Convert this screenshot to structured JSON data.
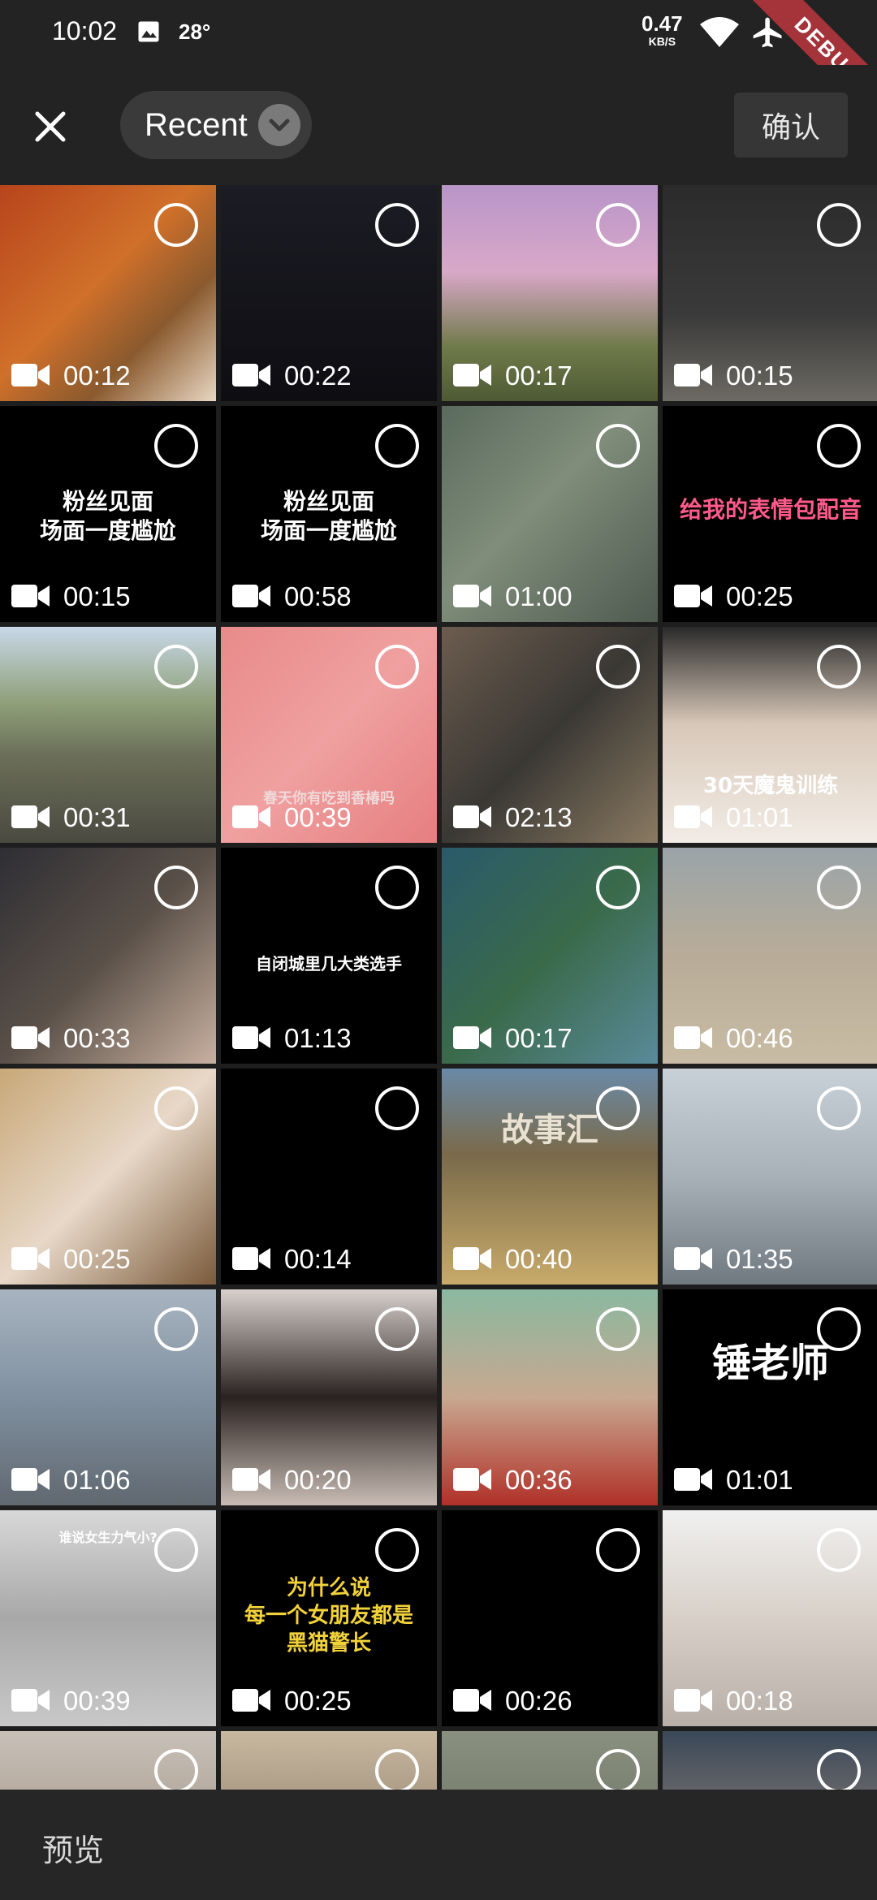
{
  "status_bar": {
    "time": "10:02",
    "temperature": "28°",
    "speed_value": "0.47",
    "speed_unit": "KB/S",
    "debug_label": "DEBUG"
  },
  "toolbar": {
    "album_label": "Recent",
    "confirm_label": "确认"
  },
  "bottom_bar": {
    "preview_label": "预览"
  },
  "colors": {
    "background": "#1e1e1e",
    "bar": "#232323",
    "pill": "#3a3a3a",
    "debug": "#a5333a"
  },
  "videos": [
    {
      "duration": "00:12",
      "overlay": ""
    },
    {
      "duration": "00:22",
      "overlay": ""
    },
    {
      "duration": "00:17",
      "overlay": ""
    },
    {
      "duration": "00:15",
      "overlay": ""
    },
    {
      "duration": "00:15",
      "overlay": "粉丝见面\n场面一度尴尬"
    },
    {
      "duration": "00:58",
      "overlay": "粉丝见面\n场面一度尴尬"
    },
    {
      "duration": "01:00",
      "overlay": ""
    },
    {
      "duration": "00:25",
      "overlay": "给我的表情包配音"
    },
    {
      "duration": "00:31",
      "overlay": ""
    },
    {
      "duration": "00:39",
      "overlay": "春天你有吃到香椿吗"
    },
    {
      "duration": "02:13",
      "overlay": ""
    },
    {
      "duration": "01:01",
      "overlay": "30天魔鬼训练"
    },
    {
      "duration": "00:33",
      "overlay": ""
    },
    {
      "duration": "01:13",
      "overlay": "自闭城里几大类选手"
    },
    {
      "duration": "00:17",
      "overlay": ""
    },
    {
      "duration": "00:46",
      "overlay": ""
    },
    {
      "duration": "00:25",
      "overlay": ""
    },
    {
      "duration": "00:14",
      "overlay": ""
    },
    {
      "duration": "00:40",
      "overlay": "故事汇"
    },
    {
      "duration": "01:35",
      "overlay": ""
    },
    {
      "duration": "01:06",
      "overlay": ""
    },
    {
      "duration": "00:20",
      "overlay": ""
    },
    {
      "duration": "00:36",
      "overlay": ""
    },
    {
      "duration": "01:01",
      "overlay": "锤老师"
    },
    {
      "duration": "00:39",
      "overlay": "谁说女生力气小?"
    },
    {
      "duration": "00:25",
      "overlay": "为什么说\n每一个女朋友都是\n黑猫警长"
    },
    {
      "duration": "00:26",
      "overlay": ""
    },
    {
      "duration": "00:18",
      "overlay": ""
    },
    {
      "duration": "",
      "overlay": ""
    },
    {
      "duration": "",
      "overlay": ""
    },
    {
      "duration": "",
      "overlay": ""
    },
    {
      "duration": "",
      "overlay": ""
    }
  ]
}
